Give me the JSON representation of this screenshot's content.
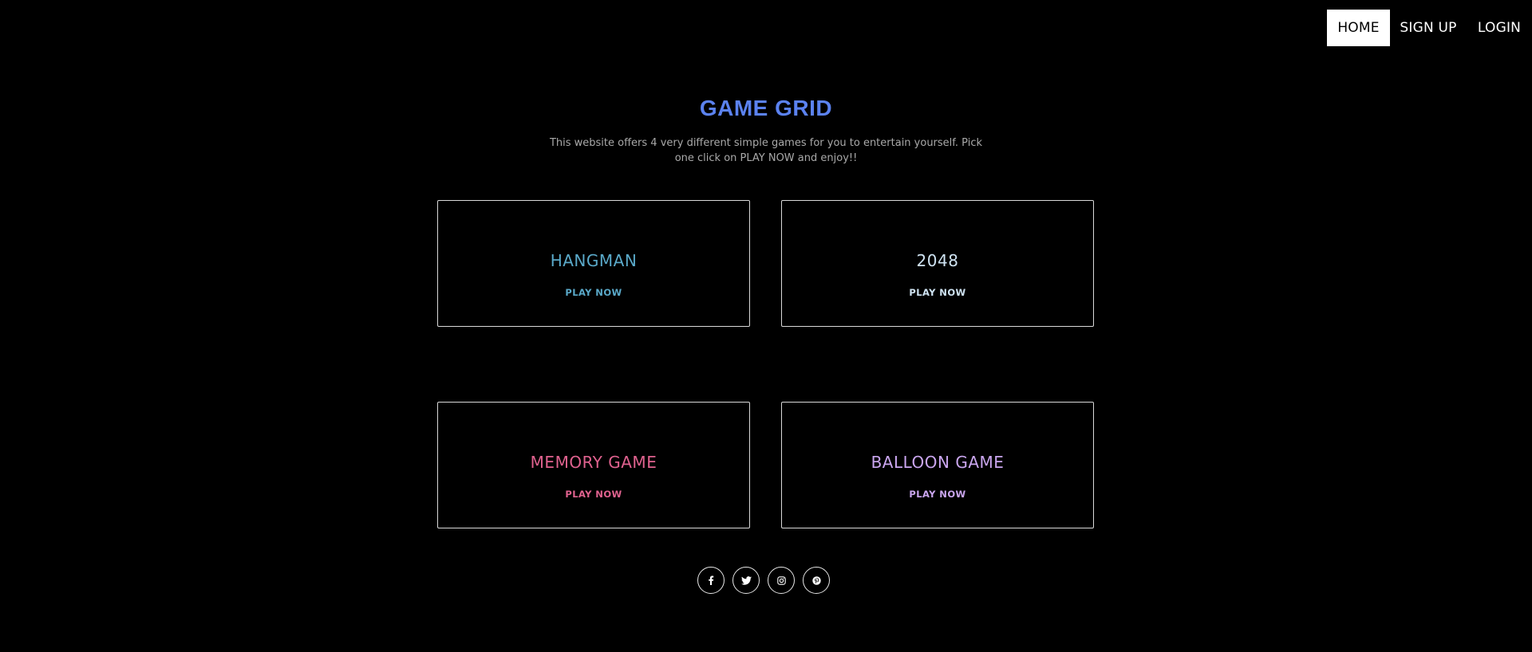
{
  "nav": {
    "home": "HOME",
    "signup": "SIGN UP",
    "login": "LOGIN"
  },
  "header": {
    "title": "GAME GRID",
    "description": "This website offers 4 very different simple games for you to entertain yourself. Pick one click on PLAY NOW and enjoy!!"
  },
  "cards": [
    {
      "title": "HANGMAN",
      "action": "PLAY NOW",
      "color": "#5aa9c9"
    },
    {
      "title": "2048",
      "action": "PLAY NOW",
      "color": "#cfe3f2"
    },
    {
      "title": "MEMORY GAME",
      "action": "PLAY NOW",
      "color": "#e0628f"
    },
    {
      "title": "BALLOON GAME",
      "action": "PLAY NOW",
      "color": "#caa6ef"
    }
  ],
  "social": [
    "facebook-icon",
    "twitter-icon",
    "instagram-icon",
    "pinterest-icon"
  ],
  "colors": {
    "background": "#000000",
    "title": "#5b82f0",
    "description": "#a9a9a9",
    "border": "#d9d9d9"
  }
}
